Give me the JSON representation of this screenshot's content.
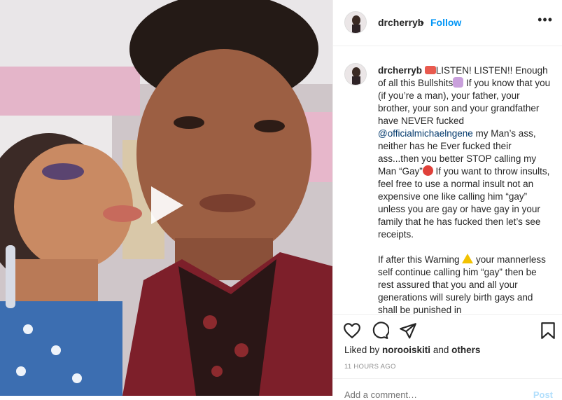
{
  "header": {
    "username": "drcherryb",
    "separator": "•",
    "follow_label": "Follow",
    "more_icon": "more-horizontal-icon"
  },
  "caption": {
    "username": "drcherryb",
    "p1_a": "LISTEN! LISTEN!! Enough of all this Bullshits",
    "p1_b": " If you know that you (if you’re a man), your father, your brother, your son and your grandfather have NEVER fucked ",
    "mention": "@officialmichaelngene",
    "p1_c": " my Man’s ass, neither has he Ever fucked their ass...then you better STOP calling my Man “Gay”",
    "p1_d": " If you want to throw insults, feel free to use a normal insult not an expensive one like calling him “gay” unless you are gay or have gay in your family that he has fucked then let’s see receipts.",
    "p2_a": "If after this Warning ",
    "p2_b": " your mannerless self continue calling him “gay” then be rest assured that you and all your generations will surely birth gays and shall be punished in"
  },
  "actions": {
    "like_icon": "heart-icon",
    "comment_icon": "comment-icon",
    "share_icon": "share-icon",
    "save_icon": "bookmark-icon"
  },
  "likes": {
    "prefix": "Liked by ",
    "user": "norooiskiti",
    "middle": " and ",
    "others": "others"
  },
  "timestamp": "11 HOURS AGO",
  "add_comment": {
    "placeholder": "Add a comment…",
    "post_label": "Post"
  },
  "colors": {
    "follow": "#0095f6",
    "mention": "#00376b",
    "post_disabled": "#b2dffc"
  }
}
